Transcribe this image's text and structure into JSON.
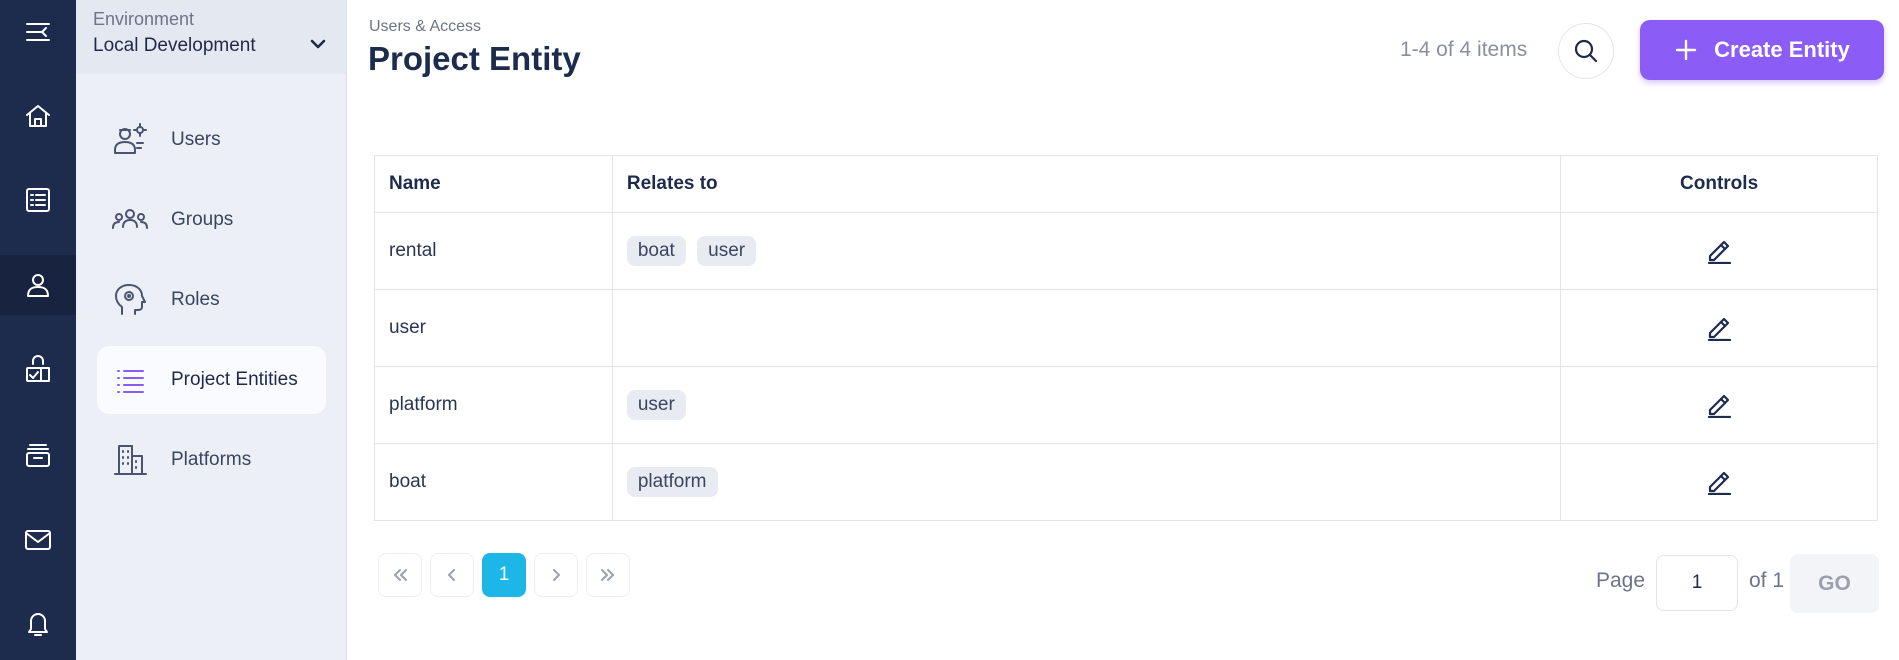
{
  "environment": {
    "label": "Environment",
    "value": "Local Development"
  },
  "rail": {
    "items": [
      {
        "name": "menu-collapse-icon"
      },
      {
        "name": "home-icon"
      },
      {
        "name": "list-icon"
      },
      {
        "name": "user-icon",
        "active": true
      },
      {
        "name": "shield-check-icon"
      },
      {
        "name": "archive-icon"
      },
      {
        "name": "mail-icon"
      },
      {
        "name": "bell-icon"
      }
    ]
  },
  "sidebar": {
    "items": [
      {
        "label": "Users",
        "icon": "users-gear-icon"
      },
      {
        "label": "Groups",
        "icon": "groups-icon"
      },
      {
        "label": "Roles",
        "icon": "roles-icon"
      },
      {
        "label": "Project Entities",
        "icon": "entities-list-icon",
        "active": true
      },
      {
        "label": "Platforms",
        "icon": "platforms-building-icon"
      }
    ]
  },
  "header": {
    "breadcrumb": "Users & Access",
    "title": "Project Entity",
    "items_count": "1-4 of 4 items",
    "create_label": "Create Entity"
  },
  "table": {
    "columns": [
      "Name",
      "Relates to",
      "Controls"
    ],
    "rows": [
      {
        "name": "rental",
        "relates_to": [
          "boat",
          "user"
        ]
      },
      {
        "name": "user",
        "relates_to": []
      },
      {
        "name": "platform",
        "relates_to": [
          "user"
        ]
      },
      {
        "name": "boat",
        "relates_to": [
          "platform"
        ]
      }
    ]
  },
  "pagination": {
    "current_page": "1",
    "page_label": "Page",
    "page_input_value": "1",
    "of_label": "of 1",
    "go_label": "GO"
  },
  "colors": {
    "rail_bg": "#1d2b4d",
    "accent": "#8b5cf6",
    "current_page": "#1eb6e6"
  }
}
